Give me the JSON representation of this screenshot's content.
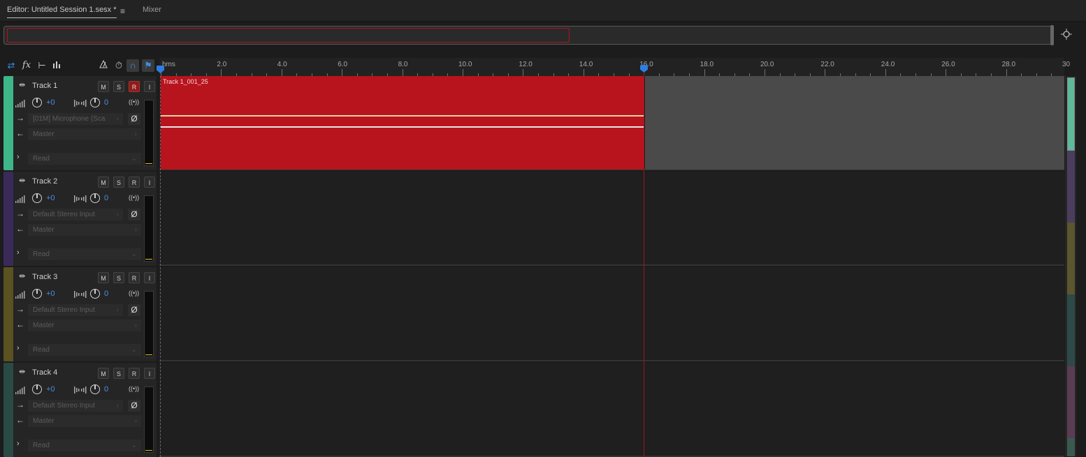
{
  "tabs": {
    "editor_label": "Editor: Untitled Session 1.sesx *",
    "menu_icon": "≡",
    "mixer_label": "Mixer"
  },
  "toolbar": {
    "icons": [
      "swap-icon",
      "fx-icon",
      "send-icon",
      "eq-icon",
      "metronome-icon",
      "clock-icon",
      "snap-icon",
      "marker-icon"
    ]
  },
  "ruler": {
    "unit_label": "hms",
    "labels": [
      "2.0",
      "4.0",
      "6.0",
      "8.0",
      "10.0",
      "12.0",
      "14.0",
      "16.0",
      "18.0",
      "20.0",
      "22.0",
      "24.0",
      "26.0",
      "28.0",
      "30"
    ]
  },
  "clip": {
    "name": "Track 1_001_25",
    "color": "#b8141e"
  },
  "tracks": [
    {
      "name": "Track 1",
      "color": "#3fb58a",
      "mute": "M",
      "solo": "S",
      "record": "R",
      "input_monitor": "I",
      "volume": "+0",
      "pan": "0",
      "input": "[01M] Microphone (Sca",
      "output": "Master",
      "automation": "Read",
      "record_armed": true
    },
    {
      "name": "Track 2",
      "color": "#3a2a5a",
      "mute": "M",
      "solo": "S",
      "record": "R",
      "input_monitor": "I",
      "volume": "+0",
      "pan": "0",
      "input": "Default Stereo Input",
      "output": "Master",
      "automation": "Read",
      "record_armed": false
    },
    {
      "name": "Track 3",
      "color": "#5a5220",
      "mute": "M",
      "solo": "S",
      "record": "R",
      "input_monitor": "I",
      "volume": "+0",
      "pan": "0",
      "input": "Default Stereo Input",
      "output": "Master",
      "automation": "Read",
      "record_armed": false
    },
    {
      "name": "Track 4",
      "color": "#2a4a44",
      "mute": "M",
      "solo": "S",
      "record": "R",
      "input_monitor": "I",
      "volume": "+0",
      "pan": "0",
      "input": "Default Stereo Input",
      "output": "Master",
      "automation": "Read",
      "record_armed": false
    }
  ],
  "colors": {
    "playhead": "#a3141d",
    "accent_blue": "#2f7de0"
  }
}
